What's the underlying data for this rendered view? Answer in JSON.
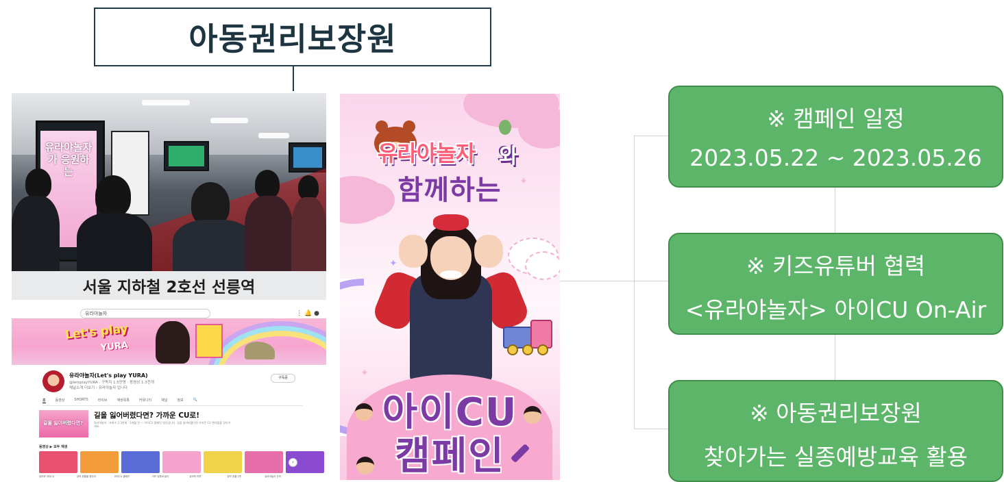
{
  "title": "아동권리보장원",
  "photo": {
    "ad_text": "유라야놀자가 응원하는",
    "caption": "서울 지하철 2호선 선릉역"
  },
  "youtube": {
    "search_text": "유라야놀자",
    "banner_title": "Let's play",
    "banner_sub": "YURA",
    "channel_name": "유라야놀자(Let's play YURA)",
    "channel_meta": "@letsplayYURA · 구독자 1.5만명 · 동영상 1.3천개",
    "channel_desc": "채널소개 더보기 › 유라야놀자 입니다",
    "subscribe_label": "구독중",
    "tabs": [
      "홈",
      "동영상",
      "SHORTS",
      "라이브",
      "재생목록",
      "커뮤니티",
      "채널",
      "정보",
      "🔍"
    ],
    "featured_thumb_text": "길을 잃어버렸다면?",
    "featured_title": "길을 잃어버렸다면? 가까운 CU로!",
    "featured_text": "유라야놀자 · 조회수 2.3천회 · 1개월 전 — 아이CU 캠페인 영상입니다. 길을 잃어버렸다면 가까운 CU 편의점을 찾아가세요.",
    "section_label": "동영상 ▶ 모두 재생",
    "shorts_colors": [
      "#e8506f",
      "#f29c3c",
      "#5a6cd6",
      "#f5a3cc",
      "#f0d34a",
      "#e66fa9",
      "#8a4bd1"
    ],
    "shorts_captions": [
      "유라와 아이CU",
      "강력 공룡을 찾아라",
      "아이CU 캠페인",
      "키즈 유튜버 놀이",
      "유라의 하루",
      "강력 공룡 2편",
      "유라야놀자 신곡"
    ]
  },
  "poster": {
    "logo": "유라야놀자",
    "logo_suffix": "와",
    "with_text": "함께하는",
    "cu_line1": "아이CU",
    "cu_line2": "캠페인"
  },
  "boxes": [
    {
      "line1": "※  캠페인 일정",
      "line2": "2023.05.22  ~ 2023.05.26"
    },
    {
      "line1": "※  키즈유튜버 협력",
      "line2": "<유라야놀자> 아이CU On-Air"
    },
    {
      "line1": "※ 아동권리보장원",
      "line2": "찾아가는 실종예방교육 활용"
    }
  ],
  "colors": {
    "title_border": "#1f3b4a",
    "box_fill": "#5cb569",
    "poster_purple": "#7b3aa4",
    "caption_bg": "#e8eaec"
  }
}
